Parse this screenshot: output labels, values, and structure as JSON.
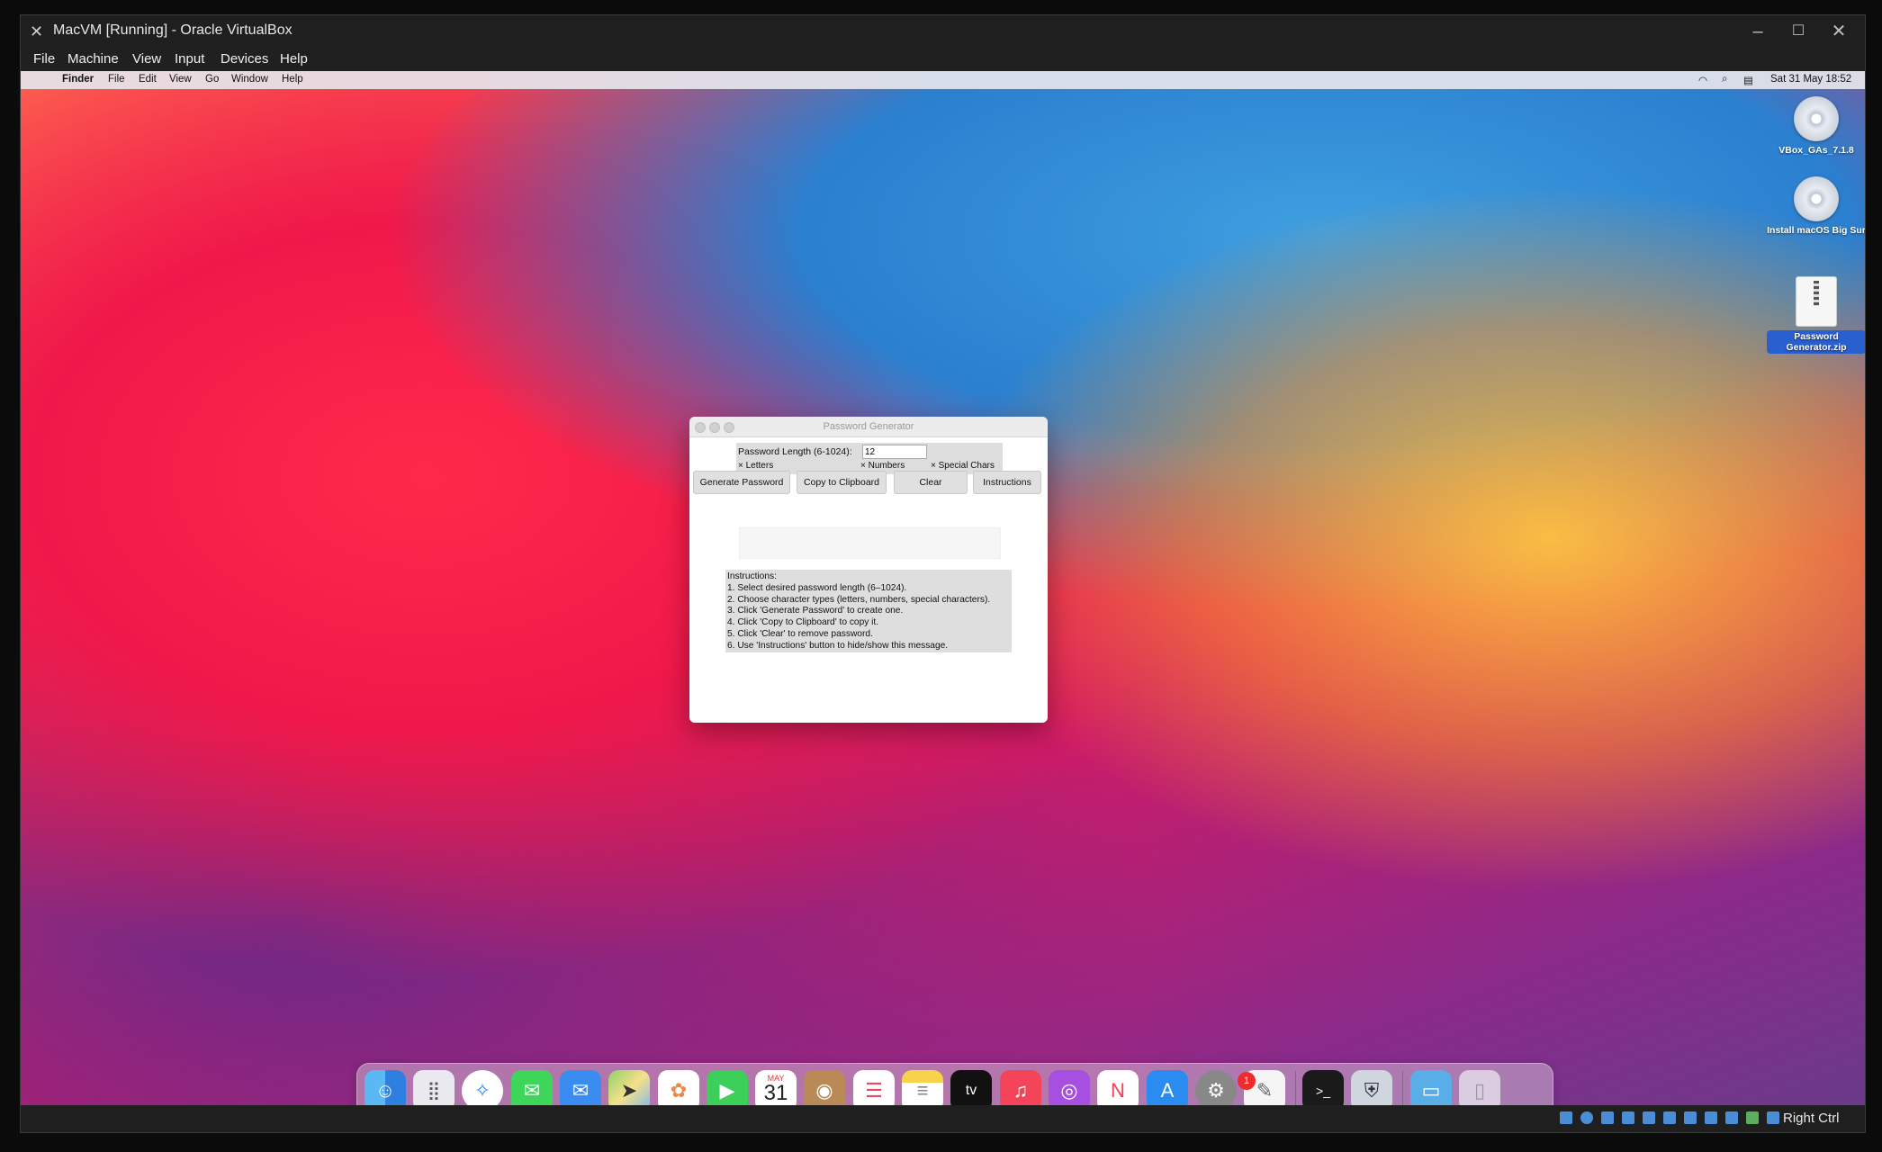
{
  "window": {
    "title": "MacVM [Running] - Oracle VirtualBox"
  },
  "host_menu": [
    "File",
    "Machine",
    "View",
    "Input",
    "Devices",
    "Help"
  ],
  "mac_menubar": {
    "app": "Finder",
    "items": [
      "File",
      "Edit",
      "View",
      "Go",
      "Window",
      "Help"
    ],
    "datetime": "Sat 31 May  18:52"
  },
  "desktop_icons": [
    {
      "label": "VBox_GAs_7.1.8",
      "icon": "disc-icon"
    },
    {
      "label": "Install macOS Big Sur",
      "icon": "disc-icon"
    },
    {
      "label": "Password Generator.zip",
      "icon": "zip-icon",
      "selected": true
    }
  ],
  "pwgen": {
    "title": "Password Generator",
    "length_label": "Password Length (6-1024):",
    "length_value": "12",
    "checkboxes": [
      {
        "label": "Letters",
        "checked": true
      },
      {
        "label": "Numbers",
        "checked": true
      },
      {
        "label": "Special Chars",
        "checked": true
      }
    ],
    "buttons": [
      "Generate Password",
      "Copy to Clipboard",
      "Clear",
      "Instructions"
    ],
    "output": "",
    "instructions": [
      "Instructions:",
      "1. Select desired password length (6–1024).",
      "2. Choose character types (letters, numbers, special characters).",
      "3. Click 'Generate Password' to create one.",
      "4. Click 'Copy to Clipboard' to copy it.",
      "5. Click 'Clear' to remove password.",
      "6. Use 'Instructions' button to hide/show this message."
    ]
  },
  "dock": {
    "calendar_month": "MAY",
    "calendar_day": "31",
    "system_prefs_badge": "1",
    "apps": [
      "finder",
      "launchpad",
      "safari",
      "messages",
      "mail",
      "maps",
      "photos",
      "facetime",
      "calendar",
      "contacts",
      "reminders",
      "notes",
      "tv",
      "music",
      "podcasts",
      "news",
      "app-store",
      "system-preferences",
      "textedit",
      "terminal",
      "password-generator",
      "downloads-folder",
      "trash"
    ]
  },
  "statusbar": {
    "host_key": "Right Ctrl"
  }
}
